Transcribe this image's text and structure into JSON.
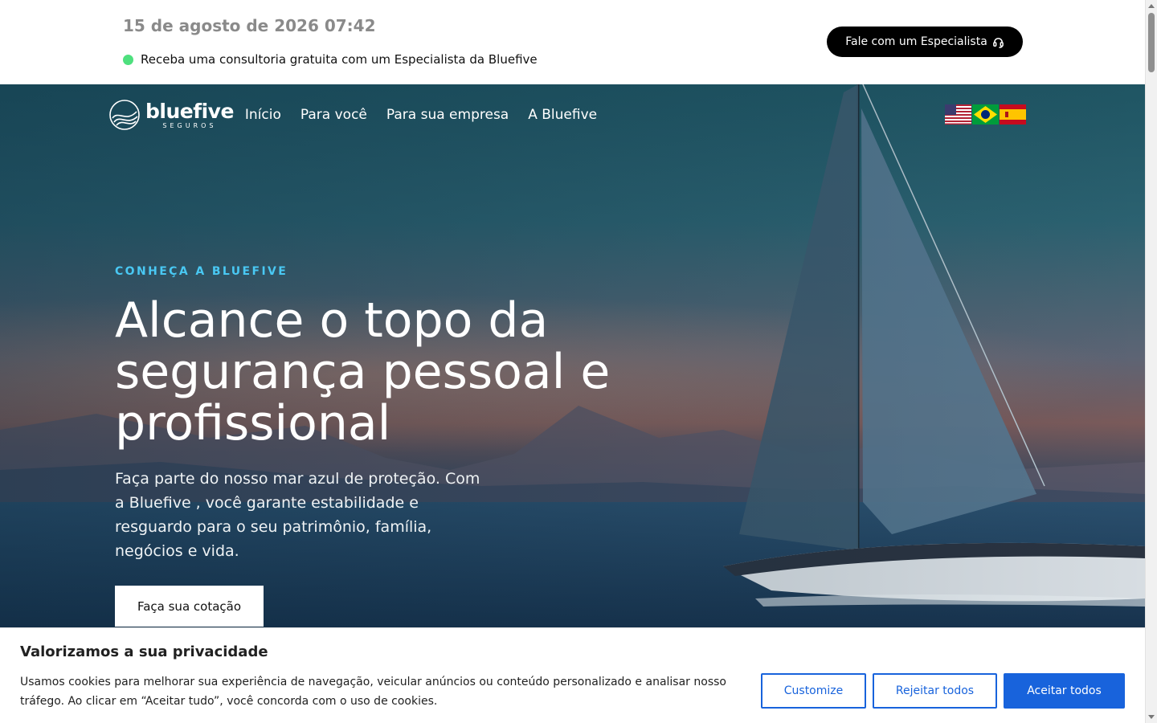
{
  "topbar": {
    "datetime": "15 de agosto de 2026 07:42",
    "consult_text": "Receba uma consultoria gratuita com um Especialista da Bluefive",
    "cta_label": "Fale com um Especialista",
    "cta_icon": "headset-icon",
    "status_color": "#4ee07e"
  },
  "nav": {
    "logo": {
      "brand": "bluefive",
      "sub": "SEGUROS"
    },
    "links": [
      "Início",
      "Para você",
      "Para sua empresa",
      "A Bluefive"
    ],
    "languages": [
      "en-us-flag",
      "pt-br-flag",
      "es-flag"
    ]
  },
  "hero": {
    "eyebrow": "CONHEÇA A BLUEFIVE",
    "headline": "Alcance o topo da segurança pessoal e profissional",
    "subtext": "Faça parte do nosso mar azul de proteção. Com a Bluefive , você garante estabilidade e resguardo para o seu patrimônio, família, negócios e vida.",
    "button_label": "Faça sua cotação",
    "eyebrow_color": "#49c8f3"
  },
  "cookie": {
    "title": "Valorizamos a sua privacidade",
    "text": "Usamos cookies para melhorar sua experiência de navegação, veicular anúncios ou conteúdo personalizado e analisar nosso tráfego. Ao clicar em “Aceitar tudo”, você concorda com o uso de cookies.",
    "customize_label": "Customize",
    "reject_label": "Rejeitar todos",
    "accept_label": "Aceitar todos",
    "accent_color": "#1863dc"
  }
}
